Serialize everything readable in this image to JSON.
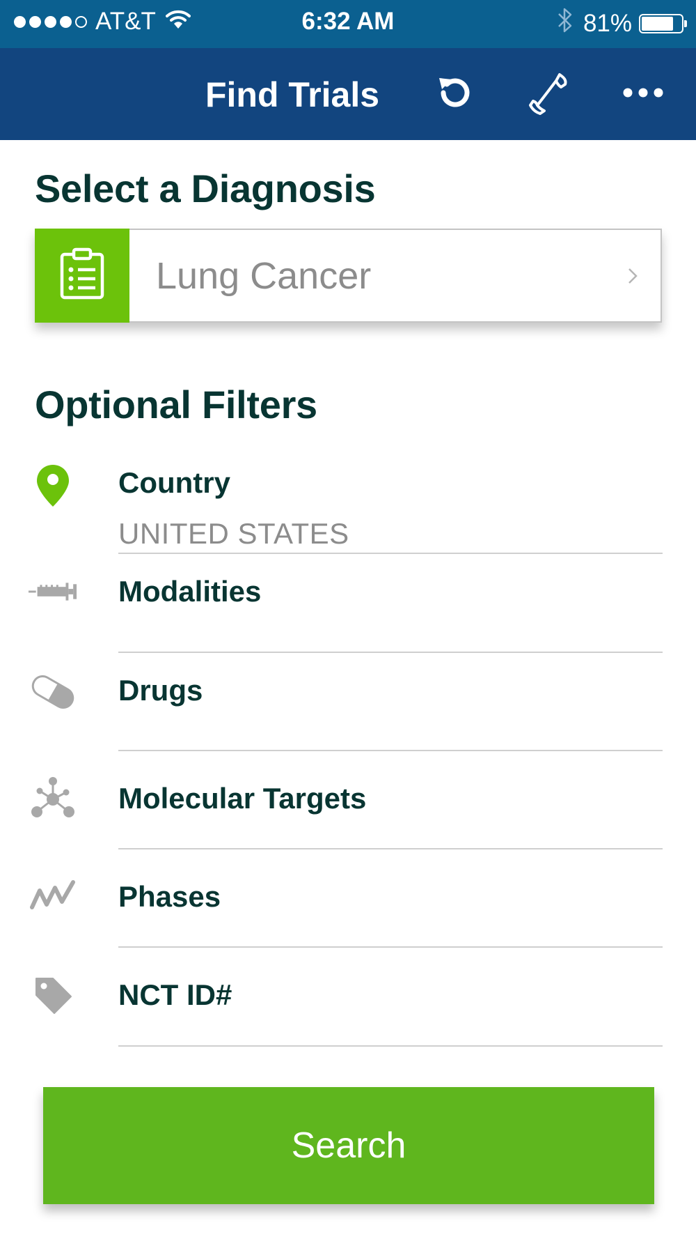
{
  "status_bar": {
    "carrier": "AT&T",
    "time": "6:32 AM",
    "battery_percent": "81%",
    "battery_level": 0.81,
    "signal_bars": 4,
    "signal_max": 5
  },
  "nav": {
    "title": "Find Trials",
    "icons": [
      "refresh-icon",
      "phone-icon",
      "more-icon"
    ]
  },
  "diagnosis": {
    "heading": "Select a Diagnosis",
    "value": "Lung Cancer",
    "icon": "clipboard-list-icon"
  },
  "filters": {
    "heading": "Optional Filters",
    "items": [
      {
        "label": "Country",
        "value": "UNITED STATES",
        "icon": "location-pin-icon"
      },
      {
        "label": "Modalities",
        "icon": "syringe-icon"
      },
      {
        "label": "Drugs",
        "icon": "pill-icon"
      },
      {
        "label": "Molecular Targets",
        "icon": "molecule-icon"
      },
      {
        "label": "Phases",
        "icon": "zigzag-icon"
      },
      {
        "label": "NCT ID#",
        "icon": "tag-icon"
      }
    ]
  },
  "search_button": {
    "label": "Search"
  },
  "colors": {
    "status_bar": "#0b6090",
    "nav_bar": "#12457f",
    "accent_green": "#6cc20b",
    "button_green": "#5fb61e",
    "heading_text": "#083532",
    "muted_text": "#8c8c8c"
  }
}
